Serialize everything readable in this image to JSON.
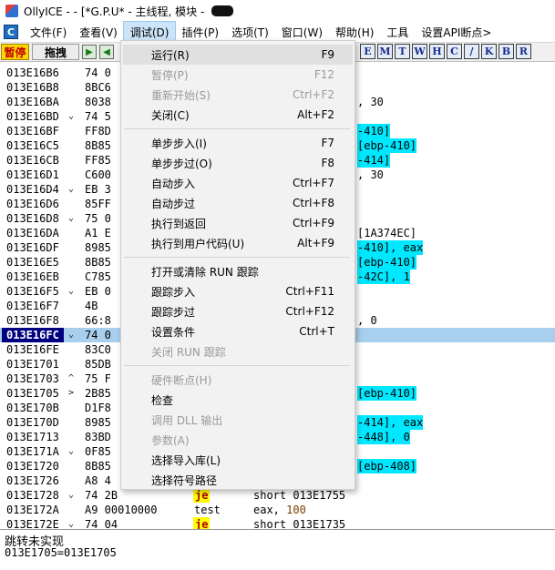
{
  "window": {
    "title": "OllyICE -  - [*G.P.U* -  主线程, 模块 - "
  },
  "menubar": {
    "items": [
      "文件(F)",
      "查看(V)",
      "调试(D)",
      "插件(P)",
      "选项(T)",
      "窗口(W)",
      "帮助(H)",
      "工具",
      "设置API断点>"
    ]
  },
  "toolbar": {
    "pause_label": "暂停",
    "drag_label": "拖拽",
    "letters": [
      "E",
      "M",
      "T",
      "W",
      "H",
      "C",
      "/",
      "K",
      "B",
      "R"
    ]
  },
  "rows": [
    {
      "addr": "013E16B6",
      "hex": "74 0",
      "tail": "",
      "tail_hl": false
    },
    {
      "addr": "013E16B8",
      "hex": "8BC6",
      "tail": "",
      "tail_hl": false
    },
    {
      "addr": "013E16BA",
      "hex": "8038",
      "tail": ", 30",
      "tail_hl": false
    },
    {
      "addr": "013E16BD",
      "hex": "74 5",
      "tail": "",
      "tail_hl": false
    },
    {
      "addr": "013E16BF",
      "hex": "FF8D",
      "tail": "-410]",
      "tail_hl": true
    },
    {
      "addr": "013E16C5",
      "hex": "8B85",
      "tail": "[ebp-410]",
      "tail_hl": true
    },
    {
      "addr": "013E16CB",
      "hex": "FF85",
      "tail": "-414]",
      "tail_hl": true
    },
    {
      "addr": "013E16D1",
      "hex": "C600",
      "tail": ", 30",
      "tail_hl": false
    },
    {
      "addr": "013E16D4",
      "hex": "EB 3",
      "tail": "",
      "tail_hl": false
    },
    {
      "addr": "013E16D6",
      "hex": "85FF",
      "tail": "",
      "tail_hl": false
    },
    {
      "addr": "013E16D8",
      "hex": "75 0",
      "tail": "",
      "tail_hl": false
    },
    {
      "addr": "013E16DA",
      "hex": "A1 E",
      "tail": "[1A374EC]",
      "tail_hl": false
    },
    {
      "addr": "013E16DF",
      "hex": "8985",
      "tail": "-410], eax",
      "tail_hl": true
    },
    {
      "addr": "013E16E5",
      "hex": "8B85",
      "tail": "[ebp-410]",
      "tail_hl": true
    },
    {
      "addr": "013E16EB",
      "hex": "C785",
      "tail": "-42C], 1",
      "tail_hl": true
    },
    {
      "addr": "013E16F5",
      "hex": "EB 0",
      "tail": "",
      "tail_hl": false
    },
    {
      "addr": "013E16F7",
      "hex": "4B",
      "tail": "",
      "tail_hl": false
    },
    {
      "addr": "013E16F8",
      "hex": "66:8",
      "tail": ", 0",
      "tail_hl": false
    },
    {
      "addr": "013E16FC",
      "hex": "74 0",
      "tail": "",
      "tail_hl": false
    },
    {
      "addr": "013E16FE",
      "hex": "83C0",
      "tail": "",
      "tail_hl": false
    },
    {
      "addr": "013E1701",
      "hex": "85DB",
      "tail": "",
      "tail_hl": false
    },
    {
      "addr": "013E1703",
      "hex": "75 F",
      "tail": "",
      "tail_hl": false
    },
    {
      "addr": "013E1705",
      "hex": "2B85",
      "tail": "[ebp-410]",
      "tail_hl": true
    },
    {
      "addr": "013E170B",
      "hex": "D1F8",
      "tail": "",
      "tail_hl": false
    },
    {
      "addr": "013E170D",
      "hex": "8985",
      "tail": "-414], eax",
      "tail_hl": true
    },
    {
      "addr": "013E1713",
      "hex": "83BD",
      "tail": "-448], 0",
      "tail_hl": true
    },
    {
      "addr": "013E171A",
      "hex": "0F85",
      "tail": "",
      "tail_hl": false
    },
    {
      "addr": "013E1720",
      "hex": "8B85",
      "tail": "[ebp-408]",
      "tail_hl": true
    },
    {
      "addr": "013E1726",
      "hex": "A8 4",
      "tail": "",
      "tail_hl": false
    }
  ],
  "tail_rows": [
    {
      "addr": "013E1728",
      "hex": "74 2B",
      "mnem": "je",
      "oper": "short 013E1755"
    },
    {
      "addr": "013E172A",
      "hex": "A9 00010000",
      "mnem": "test",
      "oper": "eax, 100"
    },
    {
      "addr": "013E172E",
      "hex": "74 04",
      "mnem": "je",
      "oper": "short 013E1735"
    }
  ],
  "selected_addr": "013E16FC",
  "info": {
    "line1": "跳转未实现",
    "line2": "013E1705=013E1705"
  },
  "debug_menu": {
    "items": [
      {
        "label": "运行(R)",
        "key": "F9",
        "disabled": false
      },
      {
        "label": "暂停(P)",
        "key": "F12",
        "disabled": true
      },
      {
        "label": "重新开始(S)",
        "key": "Ctrl+F2",
        "disabled": true
      },
      {
        "label": "关闭(C)",
        "key": "Alt+F2",
        "disabled": false
      },
      {
        "label": "单步步入(I)",
        "key": "F7",
        "disabled": false
      },
      {
        "label": "单步步过(O)",
        "key": "F8",
        "disabled": false
      },
      {
        "label": "自动步入",
        "key": "Ctrl+F7",
        "disabled": false
      },
      {
        "label": "自动步过",
        "key": "Ctrl+F8",
        "disabled": false
      },
      {
        "label": "执行到返回",
        "key": "Ctrl+F9",
        "disabled": false
      },
      {
        "label": "执行到用户代码(U)",
        "key": "Alt+F9",
        "disabled": false
      },
      {
        "label": "打开或清除 RUN 跟踪",
        "key": "",
        "disabled": false
      },
      {
        "label": "跟踪步入",
        "key": "Ctrl+F11",
        "disabled": false
      },
      {
        "label": "跟踪步过",
        "key": "Ctrl+F12",
        "disabled": false
      },
      {
        "label": "设置条件",
        "key": "Ctrl+T",
        "disabled": false
      },
      {
        "label": "关闭 RUN 跟踪",
        "key": "",
        "disabled": true
      },
      {
        "label": "硬件断点(H)",
        "key": "",
        "disabled": true
      },
      {
        "label": "检查",
        "key": "",
        "disabled": false
      },
      {
        "label": "调用 DLL 输出",
        "key": "",
        "disabled": true
      },
      {
        "label": "参数(A)",
        "key": "",
        "disabled": true
      },
      {
        "label": "选择导入库(L)",
        "key": "",
        "disabled": false
      },
      {
        "label": "选择符号路径",
        "key": "",
        "disabled": false
      }
    ]
  }
}
